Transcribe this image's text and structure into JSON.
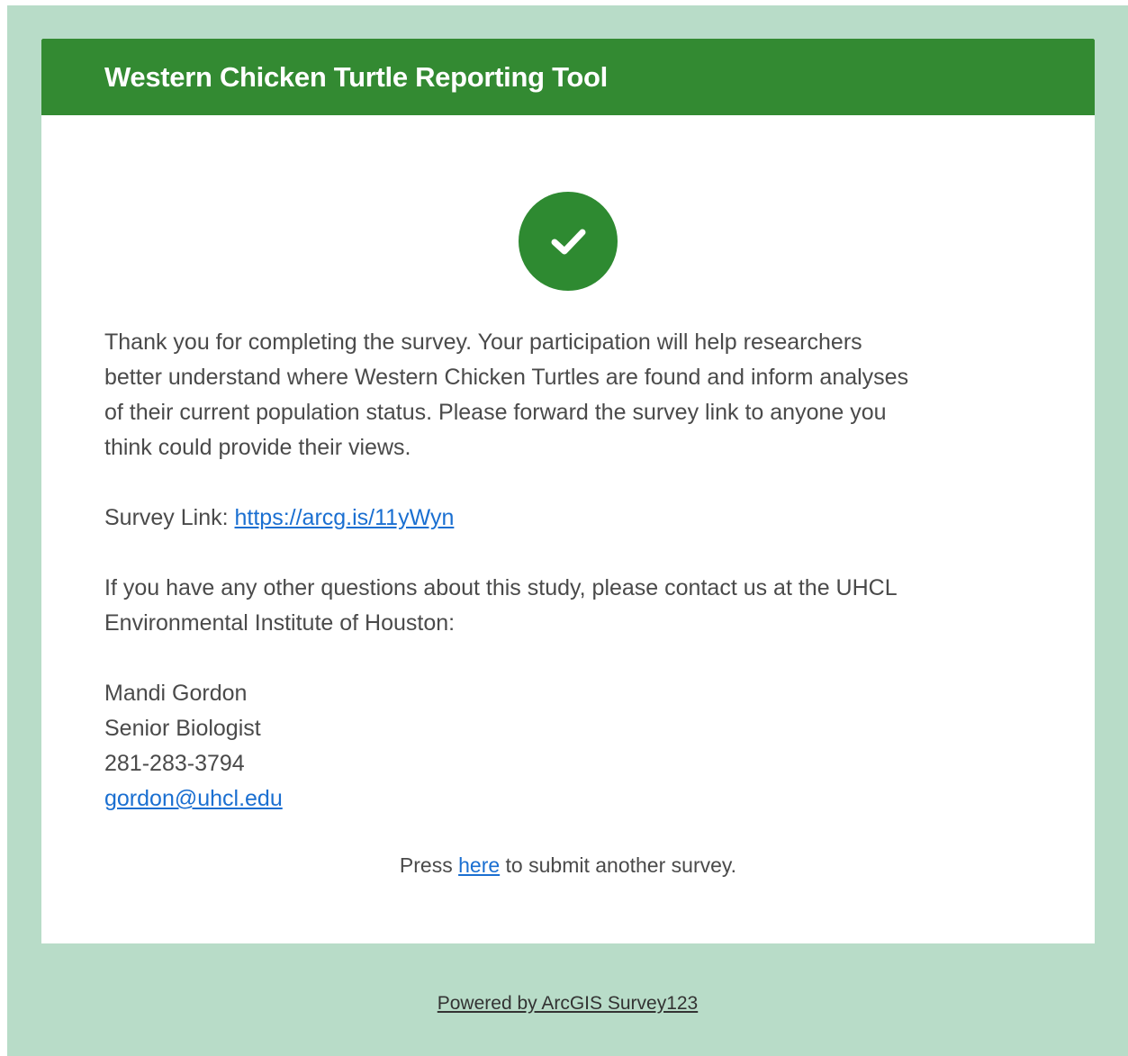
{
  "header": {
    "title": "Western Chicken Turtle Reporting Tool"
  },
  "status_icon": "checkmark-circle-icon",
  "colors": {
    "page_background": "#b8dcc8",
    "header_background": "#338a32",
    "success_icon": "#2e8a31",
    "link": "#1a6fd1"
  },
  "message": {
    "paragraph_1_lines": [
      "Thank you for completing the survey. Your participation will help researchers",
      "better understand where Western Chicken Turtles are found and inform analyses",
      "of their current population status. Please forward the survey link to anyone you",
      "think could provide their views."
    ],
    "survey_link_label": "Survey Link: ",
    "survey_link_url": "https://arcg.is/11yWyn",
    "contact_intro_lines": [
      "If you have any other questions about this study, please contact us at the UHCL",
      "Environmental Institute of Houston:"
    ],
    "contact": {
      "name": "Mandi Gordon",
      "title": "Senior Biologist",
      "phone": "281-283-3794",
      "email": "gordon@uhcl.edu"
    }
  },
  "resubmit": {
    "prefix": "Press ",
    "link_text": "here",
    "suffix": " to submit another survey."
  },
  "footer": {
    "powered_by": "Powered by ArcGIS Survey123"
  }
}
